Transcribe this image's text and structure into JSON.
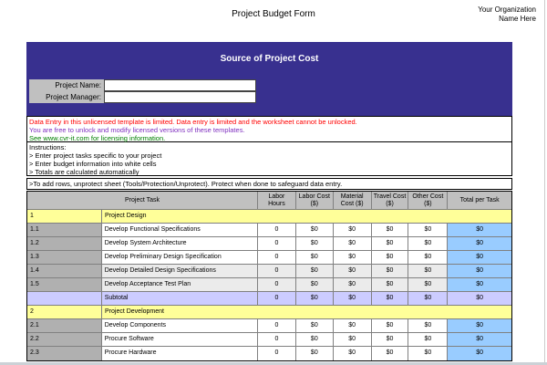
{
  "page": {
    "title": "Project Budget Form",
    "org_line1": "Your Organization",
    "org_line2": "Name Here"
  },
  "colors": {
    "banner": "#38308F",
    "section_yellow": "#FFFF99",
    "subtotal_lavender": "#CCCCFF",
    "total_blue": "#99CCFF",
    "header_gray": "#C0C0C0",
    "notice_red": "#FF0000",
    "notice_purple": "#7F2FBF",
    "notice_green": "#008000"
  },
  "banner": {
    "title": "Source of Project Cost",
    "fields": [
      {
        "label": "Project Name:",
        "value": "",
        "placeholder": ""
      },
      {
        "label": "Project Manager:",
        "value": "",
        "placeholder": ""
      }
    ]
  },
  "notice": {
    "line1": "Data Entry in this unlicensed template is limited. Data entry is limited and the worksheet cannot be unlocked.",
    "line2": "You are free to unlock and modify licensed versions of these templates.",
    "line3": "See www.cvr-it.com for licensing information."
  },
  "instructions": {
    "heading": "Instructions:",
    "items": [
      "> Enter project tasks specific to your project",
      "> Enter budget information into white cells",
      "> Totals are calculated automatically"
    ]
  },
  "add_rows_note": ">To add rows, unprotect sheet (Tools/Protection/Unprotect). Protect when done to safeguard data entry.",
  "table": {
    "headers": [
      "Project Task",
      "Labor Hours",
      "Labor Cost ($)",
      "Material Cost ($)",
      "Travel Cost ($)",
      "Other Cost ($)",
      "Total per Task"
    ],
    "rows": [
      {
        "type": "section",
        "num": "1",
        "task": "Project Design"
      },
      {
        "type": "task",
        "num": "1.1",
        "task": "Develop Functional Specifications",
        "shade": false,
        "values": [
          "0",
          "$0",
          "$0",
          "$0",
          "$0"
        ],
        "total": "$0"
      },
      {
        "type": "task",
        "num": "1.2",
        "task": "Develop System Architecture",
        "shade": false,
        "values": [
          "0",
          "$0",
          "$0",
          "$0",
          "$0"
        ],
        "total": "$0"
      },
      {
        "type": "task",
        "num": "1.3",
        "task": "Develop Preliminary Design Specification",
        "shade": false,
        "values": [
          "0",
          "$0",
          "$0",
          "$0",
          "$0"
        ],
        "total": "$0"
      },
      {
        "type": "task",
        "num": "1.4",
        "task": "Develop Detailed Design Specifications",
        "shade": true,
        "values": [
          "0",
          "$0",
          "$0",
          "$0",
          "$0"
        ],
        "total": "$0"
      },
      {
        "type": "task",
        "num": "1.5",
        "task": "Develop Acceptance Test Plan",
        "shade": true,
        "values": [
          "0",
          "$0",
          "$0",
          "$0",
          "$0"
        ],
        "total": "$0"
      },
      {
        "type": "subtotal",
        "num": "",
        "task": "Subtotal",
        "values": [
          "0",
          "$0",
          "$0",
          "$0",
          "$0"
        ],
        "total": "$0"
      },
      {
        "type": "section",
        "num": "2",
        "task": "Project Development"
      },
      {
        "type": "task",
        "num": "2.1",
        "task": "Develop Components",
        "shade": false,
        "values": [
          "0",
          "$0",
          "$0",
          "$0",
          "$0"
        ],
        "total": "$0"
      },
      {
        "type": "task",
        "num": "2.2",
        "task": "Procure Software",
        "shade": false,
        "values": [
          "0",
          "$0",
          "$0",
          "$0",
          "$0"
        ],
        "total": "$0"
      },
      {
        "type": "task",
        "num": "2.3",
        "task": "Procure Hardware",
        "shade": false,
        "values": [
          "0",
          "$0",
          "$0",
          "$0",
          "$0"
        ],
        "total": "$0"
      }
    ]
  }
}
